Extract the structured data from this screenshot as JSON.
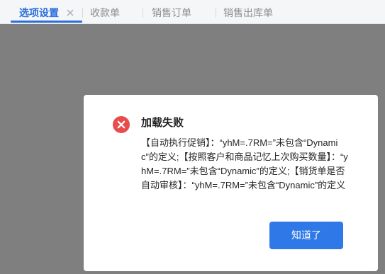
{
  "tabs": [
    {
      "label": "选项设置",
      "active": true
    },
    {
      "label": "收款单",
      "active": false
    },
    {
      "label": "销售订单",
      "active": false
    },
    {
      "label": "销售出库单",
      "active": false
    }
  ],
  "dialog": {
    "icon": "error-circle-icon",
    "title": "加载失败",
    "message": "【自动执行促销】：“yhM=.7RM=”未包含“Dynamic”的定义;【按照客户和商品记忆上次购买数量】：“yhM=.7RM=”未包含“Dynamic”的定义;【销货单是否自动审核】：“yhM=.7RM=”未包含“Dynamic”的定义",
    "ok_label": "知道了"
  },
  "colors": {
    "accent": "#2b6fdb",
    "button": "#2f78e8",
    "error": "#e84d4d",
    "overlay": "#7f7f7f"
  }
}
